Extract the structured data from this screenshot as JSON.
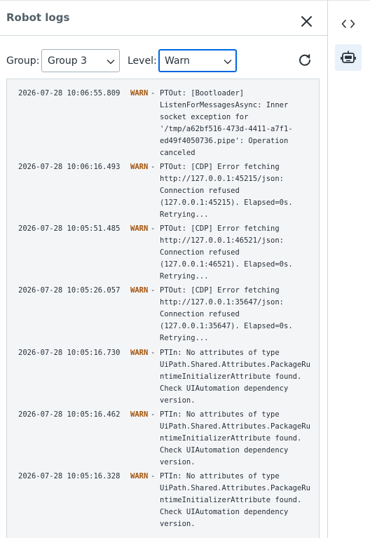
{
  "panel": {
    "title": "Robot logs"
  },
  "filters": {
    "group_label": "Group:",
    "group_value": "Group 3",
    "level_label": "Level:",
    "level_value": "Warn"
  },
  "logs": [
    {
      "timestamp": "2026-07-28 10:06:55.809",
      "level": "WARN",
      "message": "PTOut: [Bootloader]\nListenForMessagesAsync: Inner\nsocket exception for\n'/tmp/a62bf516-473d-4411-a7f1-\ned49f4050736.pipe': Operation\ncanceled"
    },
    {
      "timestamp": "2026-07-28 10:06:16.493",
      "level": "WARN",
      "message": "PTOut: [CDP] Error fetching\nhttp://127.0.0.1:45215/json:\nConnection refused\n(127.0.0.1:45215). Elapsed=0s.\nRetrying..."
    },
    {
      "timestamp": "2026-07-28 10:05:51.485",
      "level": "WARN",
      "message": "PTOut: [CDP] Error fetching\nhttp://127.0.0.1:46521/json:\nConnection refused\n(127.0.0.1:46521). Elapsed=0s.\nRetrying..."
    },
    {
      "timestamp": "2026-07-28 10:05:26.057",
      "level": "WARN",
      "message": "PTOut: [CDP] Error fetching\nhttp://127.0.0.1:35647/json:\nConnection refused\n(127.0.0.1:35647). Elapsed=0s.\nRetrying..."
    },
    {
      "timestamp": "2026-07-28 10:05:16.730",
      "level": "WARN",
      "message": "PTIn: No attributes of type\nUiPath.Shared.Attributes.PackageRu\nntimeInitializerAttribute found.\nCheck UIAutomation dependency\nversion."
    },
    {
      "timestamp": "2026-07-28 10:05:16.462",
      "level": "WARN",
      "message": "PTIn: No attributes of type\nUiPath.Shared.Attributes.PackageRu\nntimeInitializerAttribute found.\nCheck UIAutomation dependency\nversion."
    },
    {
      "timestamp": "2026-07-28 10:05:16.328",
      "level": "WARN",
      "message": "PTIn: No attributes of type\nUiPath.Shared.Attributes.PackageRu\nntimeInitializerAttribute found.\nCheck UIAutomation dependency\nversion."
    }
  ],
  "sidebar": {
    "items": [
      {
        "icon": "code-icon",
        "active": false
      },
      {
        "icon": "robot-icon",
        "active": true
      }
    ]
  },
  "colors": {
    "warn": "#a3530b",
    "focus": "#0067df",
    "log_background": "#f4f5f7"
  }
}
